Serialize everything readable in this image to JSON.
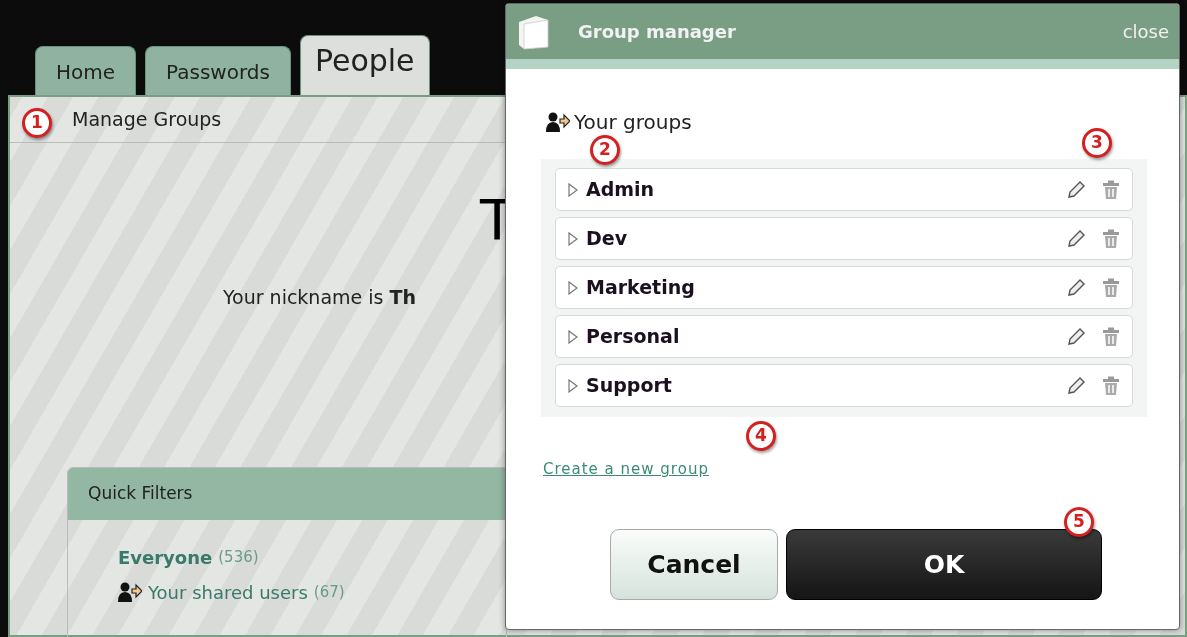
{
  "tabs": [
    {
      "label": "Home",
      "selected": false
    },
    {
      "label": "Passwords",
      "selected": false
    },
    {
      "label": "People",
      "selected": true
    }
  ],
  "section_title": "Manage Groups",
  "heading": "T",
  "nickname": "Your nickname is **Th**",
  "quick_filters": {
    "title": "Quick Filters",
    "items": [
      {
        "kind": "all",
        "label": "Everyone",
        "count": "(536)"
      },
      {
        "kind": "shared",
        "label": "Your shared users",
        "count": "(67)"
      }
    ]
  },
  "dialog": {
    "title": "Group manager",
    "close": "close",
    "section": "Your groups",
    "groups": [
      {
        "name": "Admin"
      },
      {
        "name": "Dev"
      },
      {
        "name": "Marketing"
      },
      {
        "name": "Personal"
      },
      {
        "name": "Support"
      }
    ],
    "create_link": "Create a new group",
    "buttons": [
      {
        "label": "Cancel",
        "kind": "secondary"
      },
      {
        "label": "OK",
        "kind": "primary"
      }
    ]
  },
  "callouts": [
    "1",
    "2",
    "3",
    "4",
    "5"
  ]
}
